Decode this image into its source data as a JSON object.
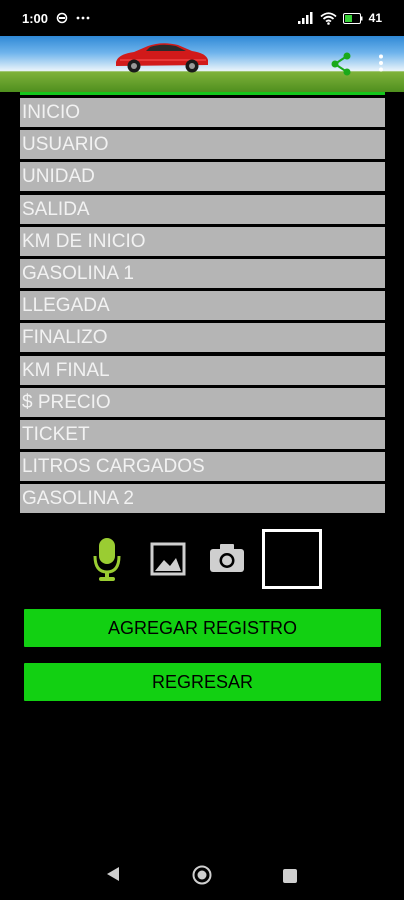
{
  "status_bar": {
    "time": "1:00",
    "battery": "41"
  },
  "header": {
    "share_icon": "share-icon",
    "more_icon": "more-vert-icon"
  },
  "fields": [
    "INICIO",
    "USUARIO",
    "UNIDAD",
    "SALIDA",
    "KM DE INICIO",
    "GASOLINA 1",
    "LLEGADA",
    "FINALIZO",
    "KM FINAL",
    "$ PRECIO",
    "TICKET",
    "LITROS CARGADOS",
    "GASOLINA 2"
  ],
  "tools": {
    "mic_icon": "microphone-icon",
    "gallery_icon": "image-gallery-icon",
    "camera_icon": "camera-icon"
  },
  "buttons": {
    "add_label": "AGREGAR REGISTRO",
    "back_label": "REGRESAR"
  },
  "colors": {
    "accent_green": "#12d012",
    "field_gray": "#b5b5b5",
    "mic_green": "#9acd32"
  }
}
